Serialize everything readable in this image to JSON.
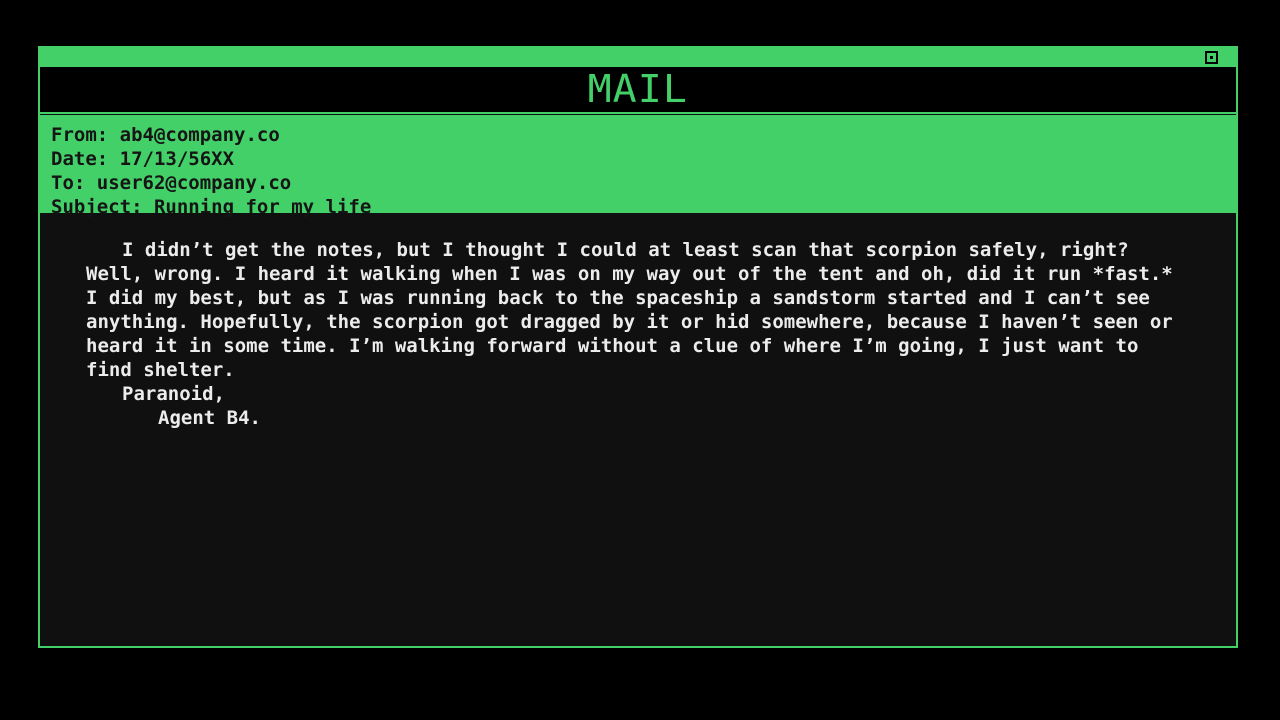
{
  "window": {
    "title": "MAIL"
  },
  "email": {
    "from": "From: ab4@company.co",
    "date": "Date: 17/13/56XX",
    "to": "To: user62@company.co",
    "subject": "Subject: Running for my life",
    "body": "I didn’t get the notes, but I thought I could at least scan that scorpion safely, right? Well, wrong. I heard it walking when I was on my way out of the tent and oh, did it run *fast.* I did my best, but as I was running back to the spaceship a sandstorm started and I can’t see anything. Hopefully, the scorpion got dragged by it or hid somewhere, because I haven’t seen or heard it in some time. I’m walking forward without a clue of where I’m going, I just want to find shelter.",
    "signoff": "Paranoid,",
    "signature": "Agent B4."
  },
  "colors": {
    "accent": "#44d068",
    "background": "#000000",
    "panel": "#101010",
    "text": "#ececec"
  }
}
